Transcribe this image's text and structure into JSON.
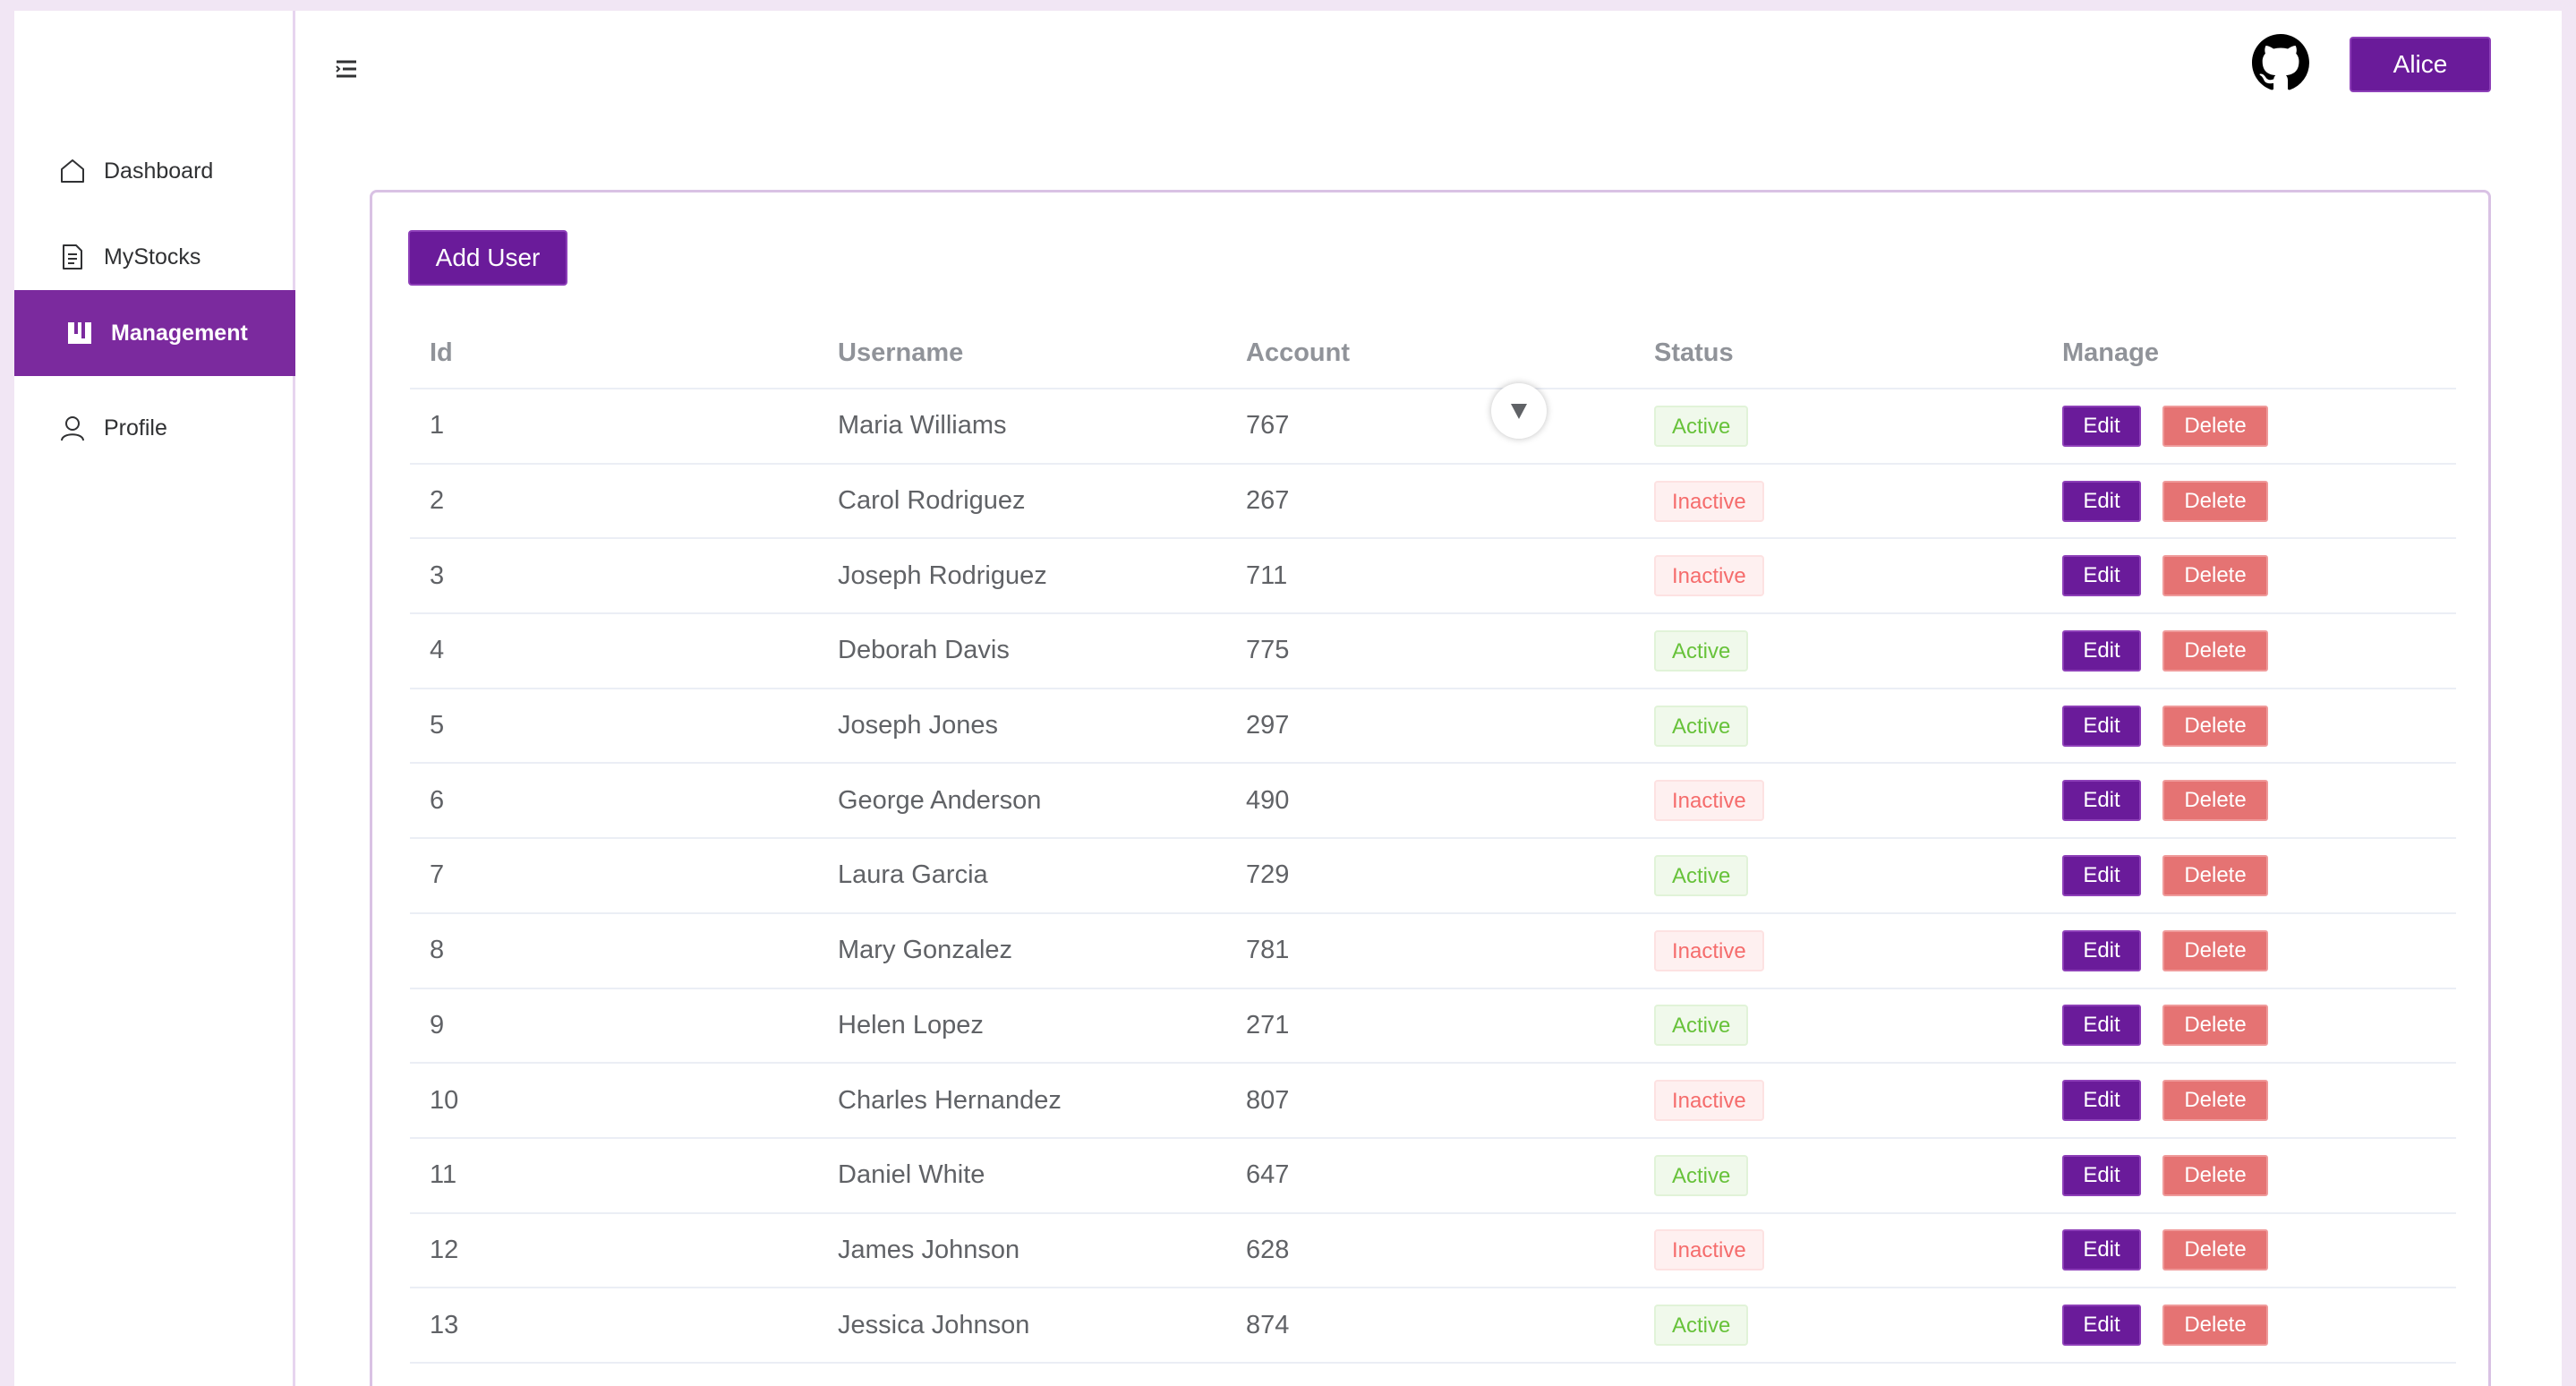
{
  "sidebar": {
    "items": [
      {
        "label": "Dashboard",
        "icon": "home-icon",
        "active": false
      },
      {
        "label": "MyStocks",
        "icon": "document-icon",
        "active": false
      },
      {
        "label": "Management",
        "icon": "management-icon",
        "active": true
      },
      {
        "label": "Profile",
        "icon": "user-icon",
        "active": false
      }
    ]
  },
  "header": {
    "menu_icon": "menu-fold-icon",
    "github_icon": "github-icon",
    "user_label": "Alice"
  },
  "main": {
    "add_user_label": "Add User",
    "table": {
      "columns": [
        "Id",
        "Username",
        "Account",
        "Status",
        "Manage"
      ],
      "rows": [
        {
          "id": "1",
          "username": "Maria Williams",
          "account": "767",
          "status": "Active"
        },
        {
          "id": "2",
          "username": "Carol Rodriguez",
          "account": "267",
          "status": "Inactive"
        },
        {
          "id": "3",
          "username": "Joseph Rodriguez",
          "account": "711",
          "status": "Inactive"
        },
        {
          "id": "4",
          "username": "Deborah Davis",
          "account": "775",
          "status": "Active"
        },
        {
          "id": "5",
          "username": "Joseph Jones",
          "account": "297",
          "status": "Active"
        },
        {
          "id": "6",
          "username": "George Anderson",
          "account": "490",
          "status": "Inactive"
        },
        {
          "id": "7",
          "username": "Laura Garcia",
          "account": "729",
          "status": "Active"
        },
        {
          "id": "8",
          "username": "Mary Gonzalez",
          "account": "781",
          "status": "Inactive"
        },
        {
          "id": "9",
          "username": "Helen Lopez",
          "account": "271",
          "status": "Active"
        },
        {
          "id": "10",
          "username": "Charles Hernandez",
          "account": "807",
          "status": "Inactive"
        },
        {
          "id": "11",
          "username": "Daniel White",
          "account": "647",
          "status": "Active"
        },
        {
          "id": "12",
          "username": "James Johnson",
          "account": "628",
          "status": "Inactive"
        },
        {
          "id": "13",
          "username": "Jessica Johnson",
          "account": "874",
          "status": "Active"
        }
      ],
      "edit_label": "Edit",
      "delete_label": "Delete"
    }
  },
  "colors": {
    "primary": "#6a1b9a",
    "sidebar_active": "#7b2a9e",
    "page_background": "#f1e6f4",
    "active_tag": "#67c23a",
    "inactive_tag": "#f56c6c",
    "delete_button": "#e57373"
  }
}
